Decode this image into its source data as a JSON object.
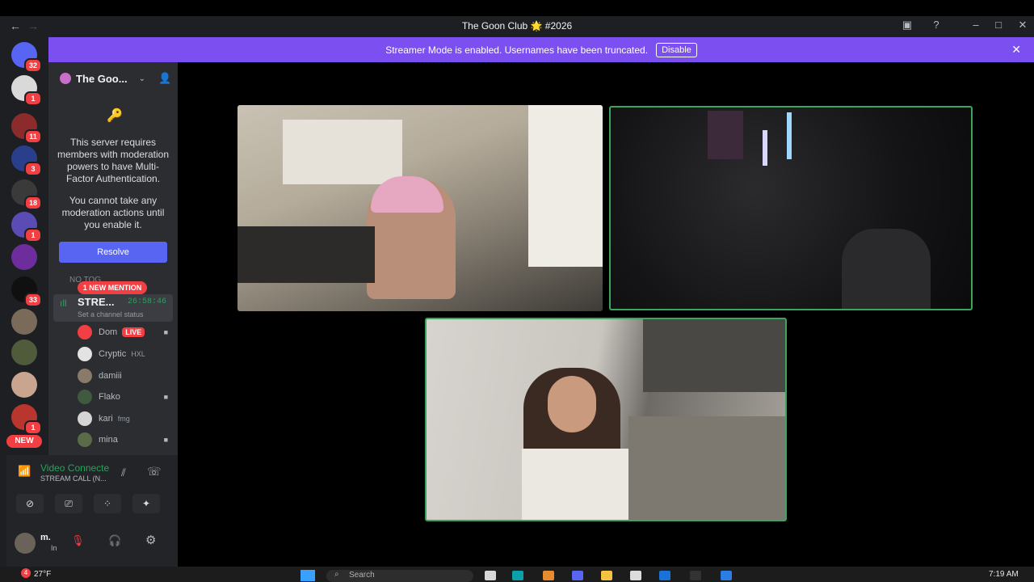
{
  "window": {
    "title": "The Goon Club 🌟 #2026",
    "back": "←",
    "forward": "→"
  },
  "banner": {
    "text": "Streamer Mode is enabled. Usernames have been truncated.",
    "disable_label": "Disable"
  },
  "rail": {
    "servers": [
      {
        "badge": "32",
        "color": "#5865f2"
      },
      {
        "badge": "1",
        "color": "#d9d9d9"
      },
      {
        "badge": "11",
        "color": "#8b2b2b"
      },
      {
        "badge": "3",
        "color": "#2a3f8c"
      },
      {
        "badge": "18",
        "color": "#3a3a3a"
      },
      {
        "badge": "1",
        "color": "#5b4bb5"
      },
      {
        "badge": "",
        "color": "#6d2d9c"
      },
      {
        "badge": "33",
        "color": "#101010"
      },
      {
        "badge": "",
        "color": "#7a6a5a"
      },
      {
        "badge": "",
        "color": "#4f5b3a"
      },
      {
        "badge": "",
        "color": "#c9a48f"
      },
      {
        "badge": "1",
        "color": "#b8362e"
      }
    ],
    "new_label": "NEW"
  },
  "server": {
    "name": "The Goo...",
    "mfa_notice": "This server requires members with moderation powers to have Multi-Factor Authentication.",
    "mfa_notice2": "You cannot take any moderation actions until you enable it.",
    "resolve_label": "Resolve"
  },
  "channels": {
    "category": "NO TOG",
    "mention_pill": "1 NEW MENTION",
    "stage_name": "STRE...",
    "stage_timer": "26:58:46",
    "stage_status": "Set a channel status",
    "members": [
      {
        "name": "Dom",
        "badge": "LIVE",
        "color": "#f23f43"
      },
      {
        "name": "Cryptic",
        "tag": "HXL",
        "color": "#e3e3e3"
      },
      {
        "name": "damiii",
        "color": "#8a7a6a"
      },
      {
        "name": "Flako",
        "color": "#3f5a3f"
      },
      {
        "name": "kari",
        "tag": "fmg",
        "color": "#d5d5d5"
      },
      {
        "name": "mina",
        "color": "#5a6b4a"
      }
    ]
  },
  "voice": {
    "title": "Video Connecte",
    "subtitle": "STREAM CALL (N..."
  },
  "user": {
    "name": "m.",
    "status": "In"
  },
  "taskbar": {
    "weather_badge": "4",
    "weather": "27°F",
    "search_placeholder": "Search",
    "time": "7:19 AM"
  }
}
